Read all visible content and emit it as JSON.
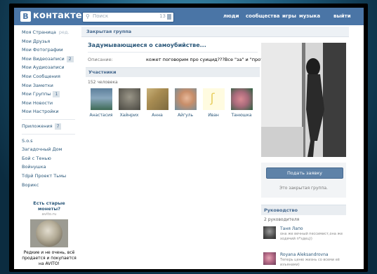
{
  "header": {
    "logo_letter": "В",
    "logo_text": "контакте",
    "search": {
      "placeholder": "Поиск",
      "count": "13"
    },
    "nav": [
      "люди",
      "сообщества",
      "игры",
      "музыка",
      "выйти"
    ]
  },
  "sidebar": {
    "items": [
      {
        "label": "Моя Страница",
        "extra": "ред."
      },
      {
        "label": "Мои Друзья"
      },
      {
        "label": "Мои Фотографии"
      },
      {
        "label": "Мои Видеозаписи",
        "badge": "2"
      },
      {
        "label": "Мои Аудиозаписи"
      },
      {
        "label": "Мои Сообщения"
      },
      {
        "label": "Мои Заметки"
      },
      {
        "label": "Мои Группы",
        "badge": "1"
      },
      {
        "label": "Мои Новости"
      },
      {
        "label": "Мои Настройки"
      }
    ],
    "apps": {
      "label": "Приложения",
      "badge": "7"
    },
    "app_items": [
      "S.o.s",
      "Загадочный Дом",
      "Бой с Тенью",
      "Войнушка",
      "Tdpй Проект Тьмы",
      "Ворикс"
    ]
  },
  "ad": {
    "title": "Есть старые монеты?",
    "site": "avito.ru",
    "description": "Редкие и не очень, всё продается и покупается на AVITO!"
  },
  "main": {
    "page_title": "Закрытая группа",
    "group_name": "Задумывающиеся о самоубийстве...",
    "description_label": "Описание:",
    "description_text": "кожет поговорим про суицид???Все \"за\" и \"против\"",
    "members_header": "Участники",
    "members_count": "152 человека",
    "members": [
      {
        "name": "Анастасия"
      },
      {
        "name": "Хайнрих"
      },
      {
        "name": "Анна"
      },
      {
        "name": "Айгуль"
      },
      {
        "name": "Иван"
      },
      {
        "name": "Танюшка"
      }
    ]
  },
  "right": {
    "join_button": "Подать заявку",
    "closed_note": "Это закрытая группа.",
    "leaders_header": "Руководство",
    "leaders_count": "2 руководителя",
    "leaders": [
      {
        "name": "Таня Лапо",
        "subtitle": "она же вечный пессимист,она же ходячий п*здец))"
      },
      {
        "name": "Royana Aleksandrovna",
        "subtitle": "Теперь ценю жизнь со всеми её изъянами)"
      }
    ]
  },
  "colors": {
    "header_bg": "#4a75a6",
    "link": "#2b587a",
    "button_bg": "#5e82a8"
  }
}
